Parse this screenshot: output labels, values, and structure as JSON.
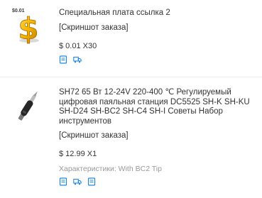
{
  "orders": [
    {
      "thumbnail": {
        "badge": "$0.01",
        "icon": "gold-dollar-sign-icon"
      },
      "title": "Специальная плата ссылка 2",
      "screenshot_label": "[Скриншот заказа]",
      "price_line": "$ 0.01 X30",
      "properties": "",
      "action_icons": [
        "document-icon",
        "delivery-truck-icon"
      ]
    },
    {
      "thumbnail": {
        "badge": "",
        "icon": "soldering-iron-icon"
      },
      "title": "SH72 65 Вт 12-24V 220-400 ℃ Регулируемый цифровая паяльная станция DC5525 SH-K SH-KU SH-D24 SH-BC2 SH-C4 SH-I Советы Набор инструментов",
      "screenshot_label": "[Скриншот заказа]",
      "price_line": "$ 12.99 X1",
      "properties": "Характеристики: With BC2 Tip",
      "action_icons": [
        "document-icon",
        "delivery-truck-icon",
        "document-icon"
      ]
    }
  ],
  "colors": {
    "accent_blue": "#1e88e5",
    "text": "#333333",
    "muted": "#999999",
    "divider": "#ececec"
  }
}
